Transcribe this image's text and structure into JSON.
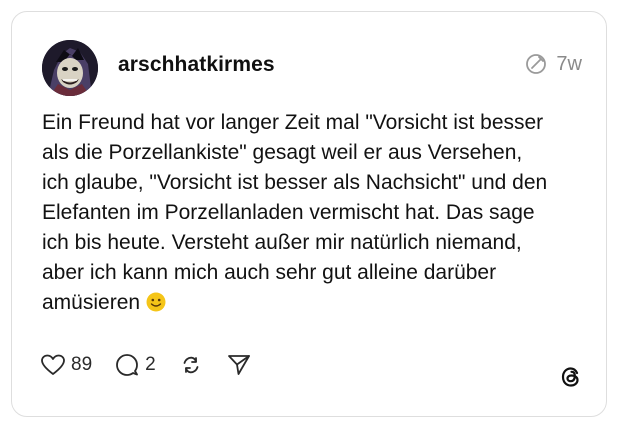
{
  "post": {
    "username": "arschhatkirmes",
    "time": "7w",
    "text": "Ein Freund hat vor langer Zeit mal \"Vorsicht ist besser\nals die Porzellankiste\" gesagt weil er aus Versehen,\nich glaube, \"Vorsicht ist besser als Nachsicht\" und den\nElefanten im Porzellanladen vermischt hat. Das sage\nich bis heute. Versteht außer mir natürlich niemand,\naber ich kann mich auch sehr gut alleine darüber\namüsieren",
    "emoji": "slightly-smiling-face",
    "likes": "89",
    "replies": "2"
  },
  "icons": {
    "like": "heart-icon",
    "reply": "comment-icon",
    "repost": "repost-icon",
    "share": "send-icon",
    "edited": "edited-icon",
    "brand": "threads-logo"
  },
  "colors": {
    "text": "#121212",
    "muted": "#8a8a8a",
    "border": "#dedede",
    "emoji": "#f5c518"
  }
}
